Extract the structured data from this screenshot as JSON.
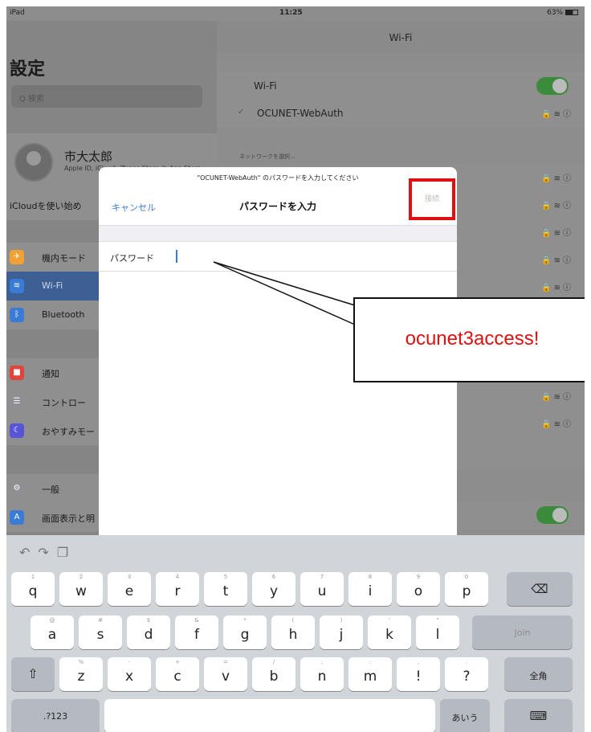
{
  "status": {
    "device": "iPad",
    "time": "11:25",
    "battery": "63%"
  },
  "sidebar": {
    "title": "設定",
    "search_placeholder": "Q 検索",
    "profile": {
      "name": "市大太郎",
      "subtitle": "Apple ID, iCloud, iTunes Store と App Store"
    },
    "icloud_text": "iCloudを使い始め",
    "items": [
      {
        "label": "機内モード",
        "icon": "airplane-icon",
        "color": "#f2a033"
      },
      {
        "label": "Wi-Fi",
        "icon": "wifi-icon",
        "color": "#3a7bd5"
      },
      {
        "label": "Bluetooth",
        "icon": "bluetooth-icon",
        "color": "#3a7bd5"
      },
      {
        "label": "通知",
        "icon": "notification-icon",
        "color": "#e0443a"
      },
      {
        "label": "コントロー",
        "icon": "control-center-icon",
        "color": "#8e8e93"
      },
      {
        "label": "おやすみモー",
        "icon": "moon-icon",
        "color": "#5856d6"
      },
      {
        "label": "一般",
        "icon": "gear-icon",
        "color": "#8e8e93"
      },
      {
        "label": "画面表示と明",
        "icon": "display-icon",
        "color": "#3a7bd5"
      }
    ]
  },
  "wifi": {
    "nav_title": "Wi-Fi",
    "toggle_label": "Wi-Fi",
    "connected_network": "OCUNET-WebAuth",
    "section_label": "ネットワークを選択..."
  },
  "dialog": {
    "prompt": "\"OCUNET-WebAuth\" のパスワードを入力してください",
    "cancel": "キャンセル",
    "title": "パスワードを入力",
    "join": "接続",
    "password_label": "パスワード"
  },
  "callout": {
    "text": "ocunet3access!",
    "color": "#e01010"
  },
  "keyboard": {
    "rows": [
      [
        {
          "k": "q",
          "s": "1"
        },
        {
          "k": "w",
          "s": "2"
        },
        {
          "k": "e",
          "s": "3"
        },
        {
          "k": "r",
          "s": "4"
        },
        {
          "k": "t",
          "s": "5"
        },
        {
          "k": "y",
          "s": "6"
        },
        {
          "k": "u",
          "s": "7"
        },
        {
          "k": "i",
          "s": "8"
        },
        {
          "k": "o",
          "s": "9"
        },
        {
          "k": "p",
          "s": "0"
        }
      ],
      [
        {
          "k": "a",
          "s": "@"
        },
        {
          "k": "s",
          "s": "#"
        },
        {
          "k": "d",
          "s": "$"
        },
        {
          "k": "f",
          "s": "&"
        },
        {
          "k": "g",
          "s": "*"
        },
        {
          "k": "h",
          "s": "("
        },
        {
          "k": "j",
          "s": ")"
        },
        {
          "k": "k",
          "s": "'"
        },
        {
          "k": "l",
          "s": "\""
        }
      ],
      [
        {
          "k": "z",
          "s": "%"
        },
        {
          "k": "x",
          "s": "-"
        },
        {
          "k": "c",
          "s": "+"
        },
        {
          "k": "v",
          "s": "="
        },
        {
          "k": "b",
          "s": "/"
        },
        {
          "k": "n",
          "s": ";"
        },
        {
          "k": "m",
          "s": ":"
        },
        {
          "k": "!",
          "s": ","
        },
        {
          "k": "?",
          "s": "."
        }
      ]
    ],
    "backspace_icon": "backspace-icon",
    "join_label": "Join",
    "shift_icon": "shift-icon",
    "zenkaku": "全角",
    "numbers_label": ".?123",
    "kana_label": "あいう",
    "hide_keyboard_icon": "keyboard-hide-icon"
  }
}
